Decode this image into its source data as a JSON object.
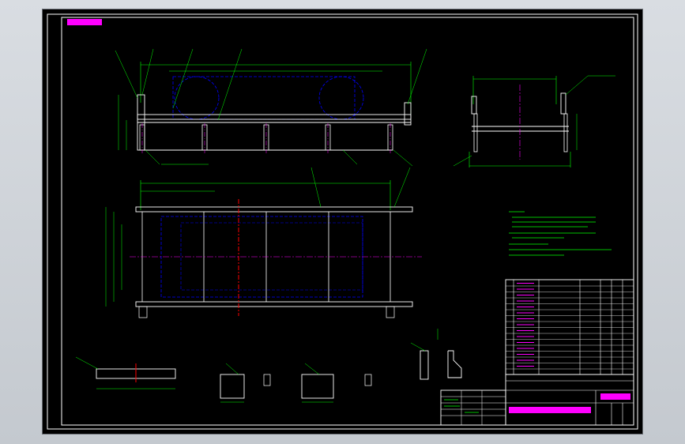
{
  "colors": {
    "background": "#000000",
    "frame": "#ffffff",
    "geometry": "#ffffff",
    "dimension": "#00ff00",
    "leader": "#00ff00",
    "centerline": "#ff00ff",
    "hidden": "#0000ff",
    "section": "#ff0000",
    "tag_fill": "#ff00ff",
    "text": "#ffffff",
    "notes_text": "#00ff00"
  },
  "drawing": {
    "frame_tag": "",
    "view_labels": [
      "",
      "",
      ""
    ],
    "notes_title": "",
    "title_block": {
      "row_1": "",
      "row_2": "",
      "drawing_no": "",
      "stamp_left": "",
      "stamp_right": ""
    }
  }
}
